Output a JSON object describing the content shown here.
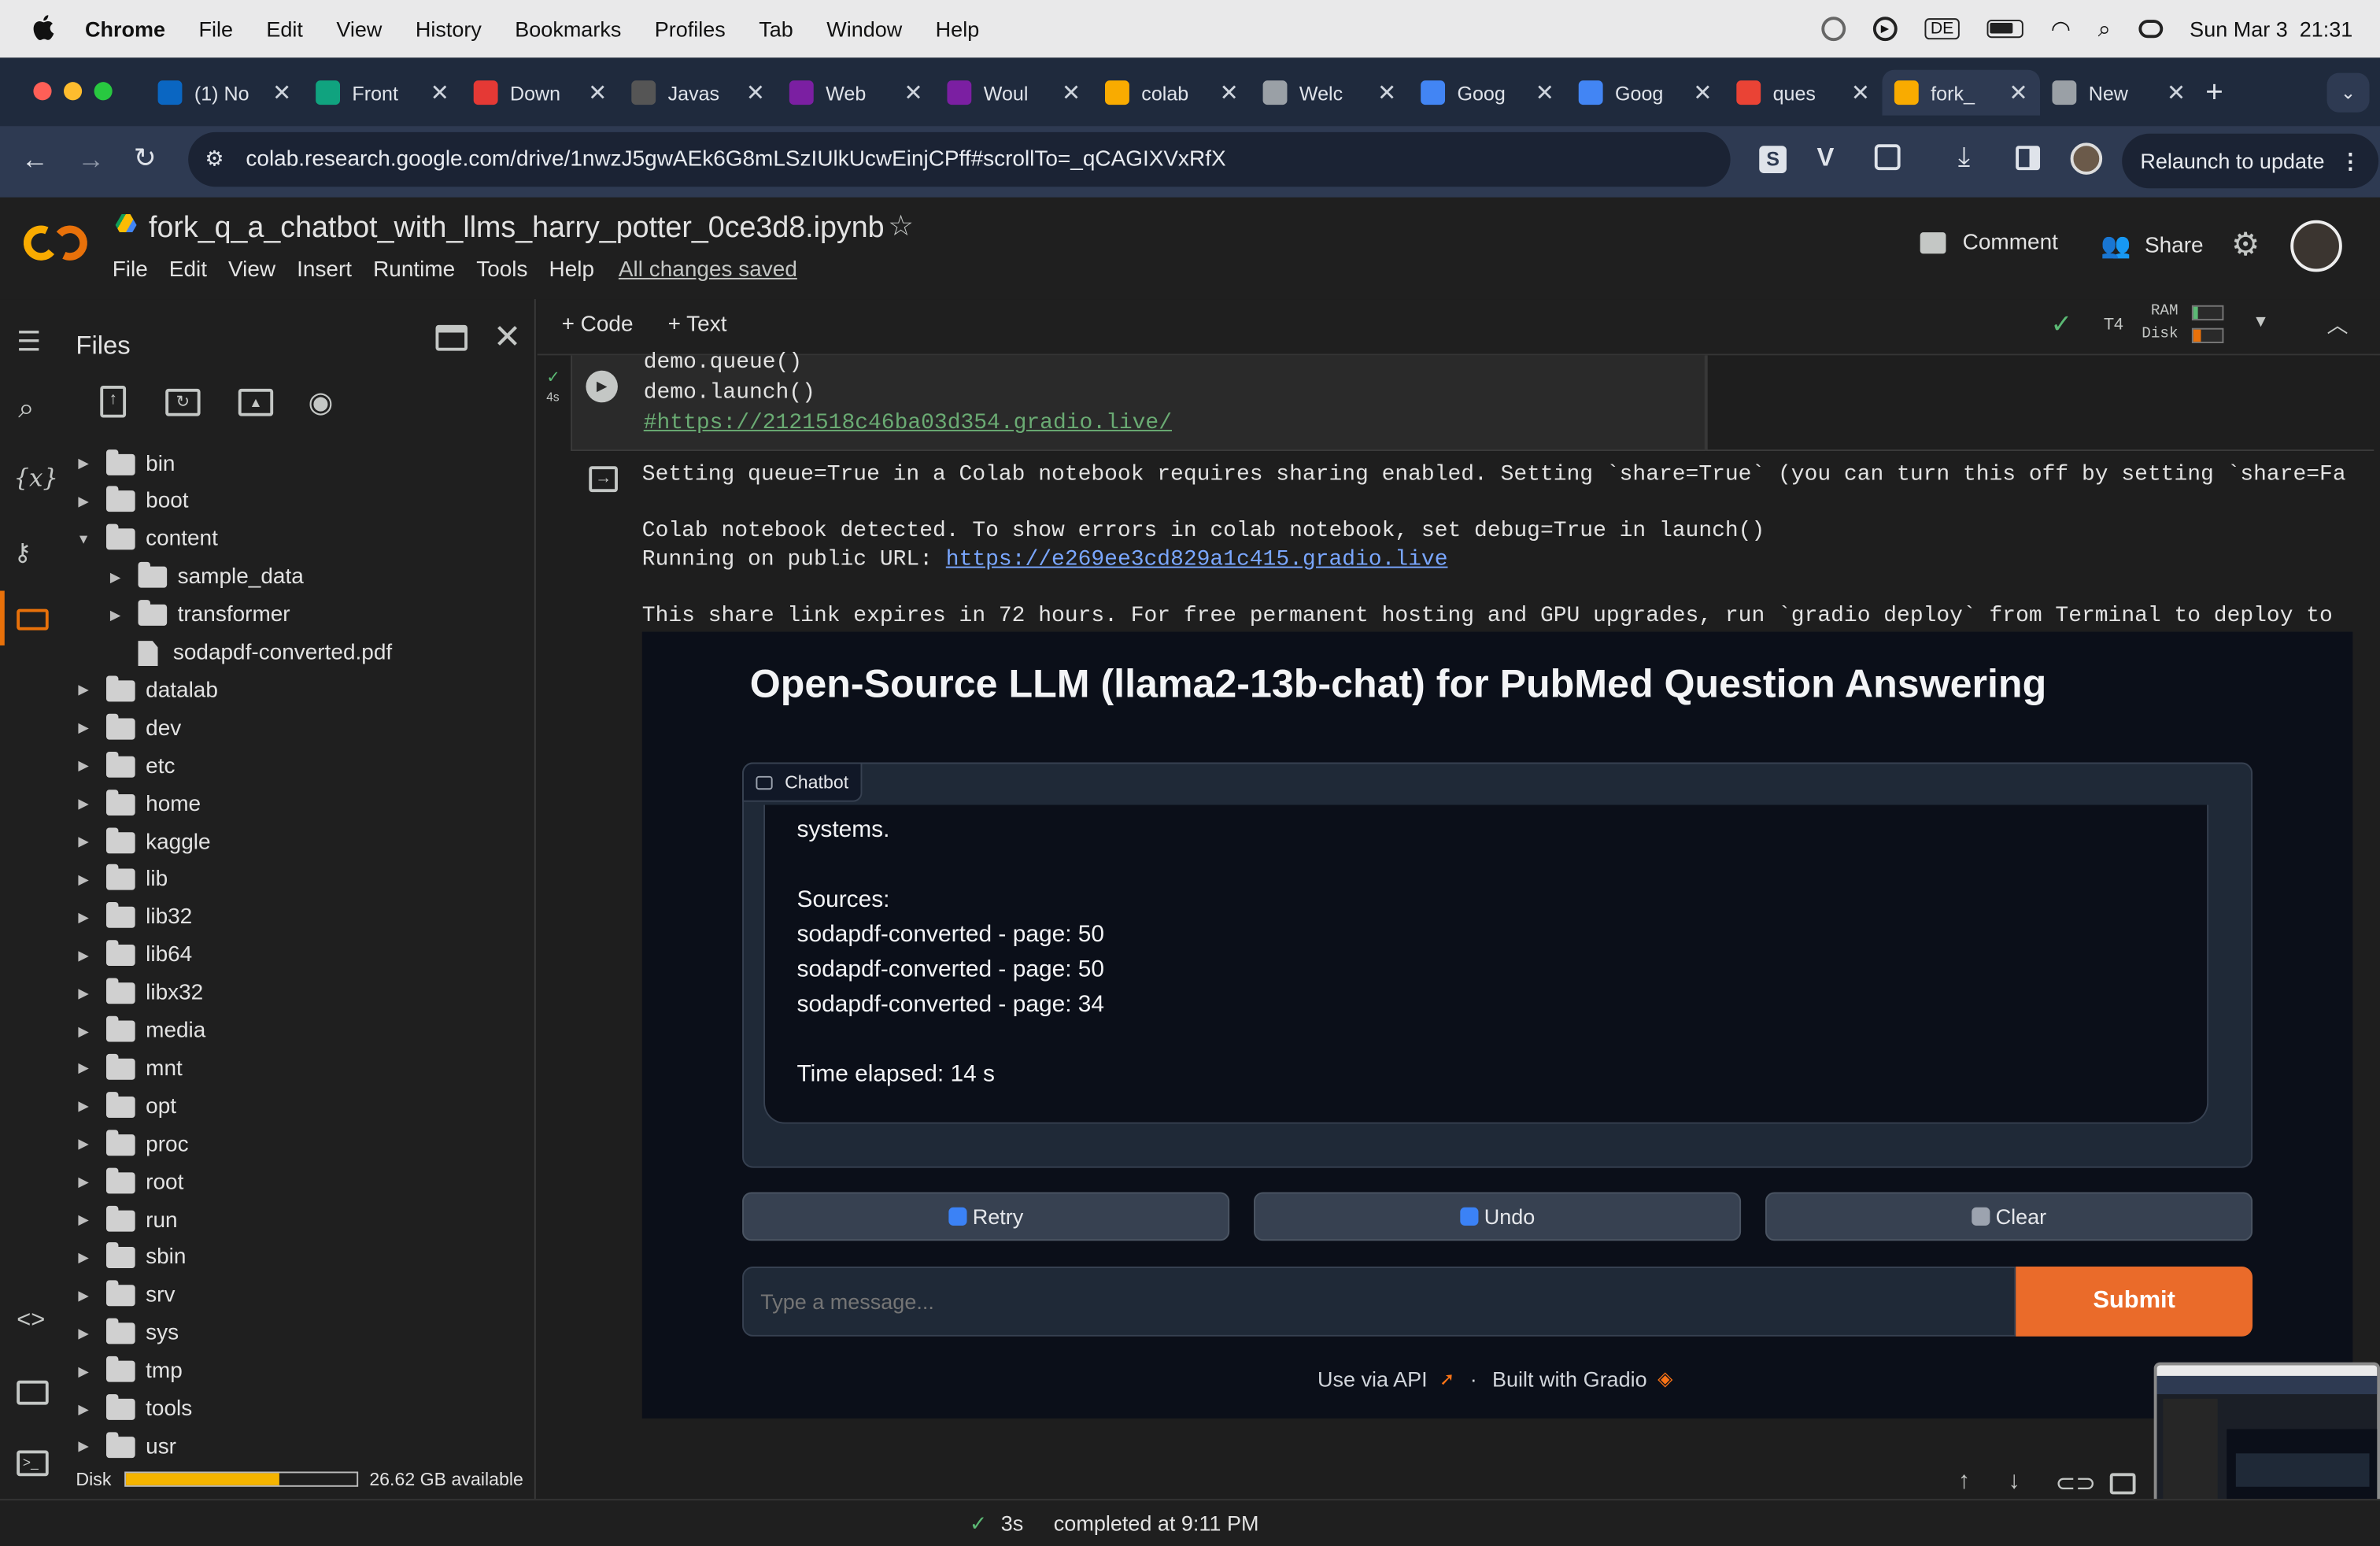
{
  "menubar": {
    "app": "Chrome",
    "items": [
      "File",
      "Edit",
      "View",
      "History",
      "Bookmarks",
      "Profiles",
      "Tab",
      "Window",
      "Help"
    ],
    "keyboard": "DE",
    "clock": "Sun Mar 3  21:31"
  },
  "tabs": [
    {
      "title": "(1) No",
      "icon": "linkedin-icon",
      "color": "#0a66c2"
    },
    {
      "title": "Front",
      "icon": "chatgpt-icon",
      "color": "#10a37f"
    },
    {
      "title": "Down",
      "icon": "heart-icon",
      "color": "#e53935"
    },
    {
      "title": "Javas",
      "icon": "javascript-icon",
      "color": "#555555"
    },
    {
      "title": "Web",
      "icon": "slack-icon",
      "color": "#7b1fa2"
    },
    {
      "title": "Woul",
      "icon": "slack-icon",
      "color": "#7b1fa2"
    },
    {
      "title": "colab",
      "icon": "colab-icon",
      "color": "#f9ab00"
    },
    {
      "title": "Welc",
      "icon": "globe-icon",
      "color": "#9aa0a6"
    },
    {
      "title": "Goog",
      "icon": "google-icon",
      "color": "#4285f4"
    },
    {
      "title": "Goog",
      "icon": "google-icon",
      "color": "#4285f4"
    },
    {
      "title": "ques",
      "icon": "gmail-icon",
      "color": "#ea4335"
    },
    {
      "title": "fork_",
      "icon": "colab-icon",
      "color": "#f9ab00"
    },
    {
      "title": "New",
      "icon": "chrome-icon",
      "color": "#9aa0a6"
    }
  ],
  "address": {
    "url": "colab.research.google.com/drive/1nwzJ5gwAEk6G8mLSzIUlkUcwEinjCPff#scrollTo=_qCAGIXVxRfX",
    "relaunch": "Relaunch to update"
  },
  "colab": {
    "notebook_title": "fork_q_a_chatbot_with_llms_harry_potter_0ce3d8.ipynb",
    "menu": [
      "File",
      "Edit",
      "View",
      "Insert",
      "Runtime",
      "Tools",
      "Help"
    ],
    "saved_status": "All changes saved",
    "comment": "Comment",
    "share": "Share",
    "add_code": "+ Code",
    "add_text": "+ Text",
    "gpu": "T4",
    "ram": "RAM",
    "disk": "Disk"
  },
  "files": {
    "title": "Files",
    "tree": [
      {
        "name": "bin",
        "type": "folder",
        "depth": 0,
        "expanded": false
      },
      {
        "name": "boot",
        "type": "folder",
        "depth": 0,
        "expanded": false
      },
      {
        "name": "content",
        "type": "folder",
        "depth": 0,
        "expanded": true
      },
      {
        "name": "sample_data",
        "type": "folder",
        "depth": 1,
        "expanded": false
      },
      {
        "name": "transformer",
        "type": "folder",
        "depth": 1,
        "expanded": false
      },
      {
        "name": "sodapdf-converted.pdf",
        "type": "file",
        "depth": 1
      },
      {
        "name": "datalab",
        "type": "folder",
        "depth": 0,
        "expanded": false
      },
      {
        "name": "dev",
        "type": "folder",
        "depth": 0,
        "expanded": false
      },
      {
        "name": "etc",
        "type": "folder",
        "depth": 0,
        "expanded": false
      },
      {
        "name": "home",
        "type": "folder",
        "depth": 0,
        "expanded": false
      },
      {
        "name": "kaggle",
        "type": "folder",
        "depth": 0,
        "expanded": false
      },
      {
        "name": "lib",
        "type": "folder",
        "depth": 0,
        "expanded": false
      },
      {
        "name": "lib32",
        "type": "folder",
        "depth": 0,
        "expanded": false
      },
      {
        "name": "lib64",
        "type": "folder",
        "depth": 0,
        "expanded": false
      },
      {
        "name": "libx32",
        "type": "folder",
        "depth": 0,
        "expanded": false
      },
      {
        "name": "media",
        "type": "folder",
        "depth": 0,
        "expanded": false
      },
      {
        "name": "mnt",
        "type": "folder",
        "depth": 0,
        "expanded": false
      },
      {
        "name": "opt",
        "type": "folder",
        "depth": 0,
        "expanded": false
      },
      {
        "name": "proc",
        "type": "folder",
        "depth": 0,
        "expanded": false
      },
      {
        "name": "root",
        "type": "folder",
        "depth": 0,
        "expanded": false
      },
      {
        "name": "run",
        "type": "folder",
        "depth": 0,
        "expanded": false
      },
      {
        "name": "sbin",
        "type": "folder",
        "depth": 0,
        "expanded": false
      },
      {
        "name": "srv",
        "type": "folder",
        "depth": 0,
        "expanded": false
      },
      {
        "name": "sys",
        "type": "folder",
        "depth": 0,
        "expanded": false
      },
      {
        "name": "tmp",
        "type": "folder",
        "depth": 0,
        "expanded": false
      },
      {
        "name": "tools",
        "type": "folder",
        "depth": 0,
        "expanded": false
      },
      {
        "name": "usr",
        "type": "folder",
        "depth": 0,
        "expanded": false
      }
    ],
    "disk_label": "Disk",
    "disk_used_fraction": 0.66,
    "disk_available": "26.62 GB available"
  },
  "cell": {
    "run_time": "4s",
    "code_lines": [
      "demo.queue()",
      "demo.launch()",
      "#https://2121518c46ba03d354.gradio.live/"
    ],
    "output_lines": [
      "Setting queue=True in a Colab notebook requires sharing enabled. Setting `share=True` (you can turn this off by setting `share=Fa",
      "Colab notebook detected. To show errors in colab notebook, set debug=True in launch()",
      "Running on public URL: ",
      "This share link expires in 72 hours. For free permanent hosting and GPU upgrades, run `gradio deploy` from Terminal to deploy to"
    ],
    "public_url": "https://e269ee3cd829a1c415.gradio.live"
  },
  "gradio": {
    "title": "Open-Source LLM (llama2-13b-chat) for PubMed Question Answering",
    "chatbot_label": "Chatbot",
    "message_lines": [
      "systems.",
      "",
      "Sources:",
      "sodapdf-converted - page: 50",
      "sodapdf-converted - page: 50",
      "sodapdf-converted - page: 34",
      "",
      "Time elapsed: 14 s"
    ],
    "retry": "Retry",
    "undo": "Undo",
    "clear": "Clear",
    "input_placeholder": "Type a message...",
    "submit": "Submit",
    "footer_api": "Use via API",
    "footer_sep": "·",
    "footer_built": "Built with Gradio",
    "accent": "#f97316"
  },
  "status": {
    "duration": "3s",
    "completed": "completed at 9:11 PM"
  }
}
